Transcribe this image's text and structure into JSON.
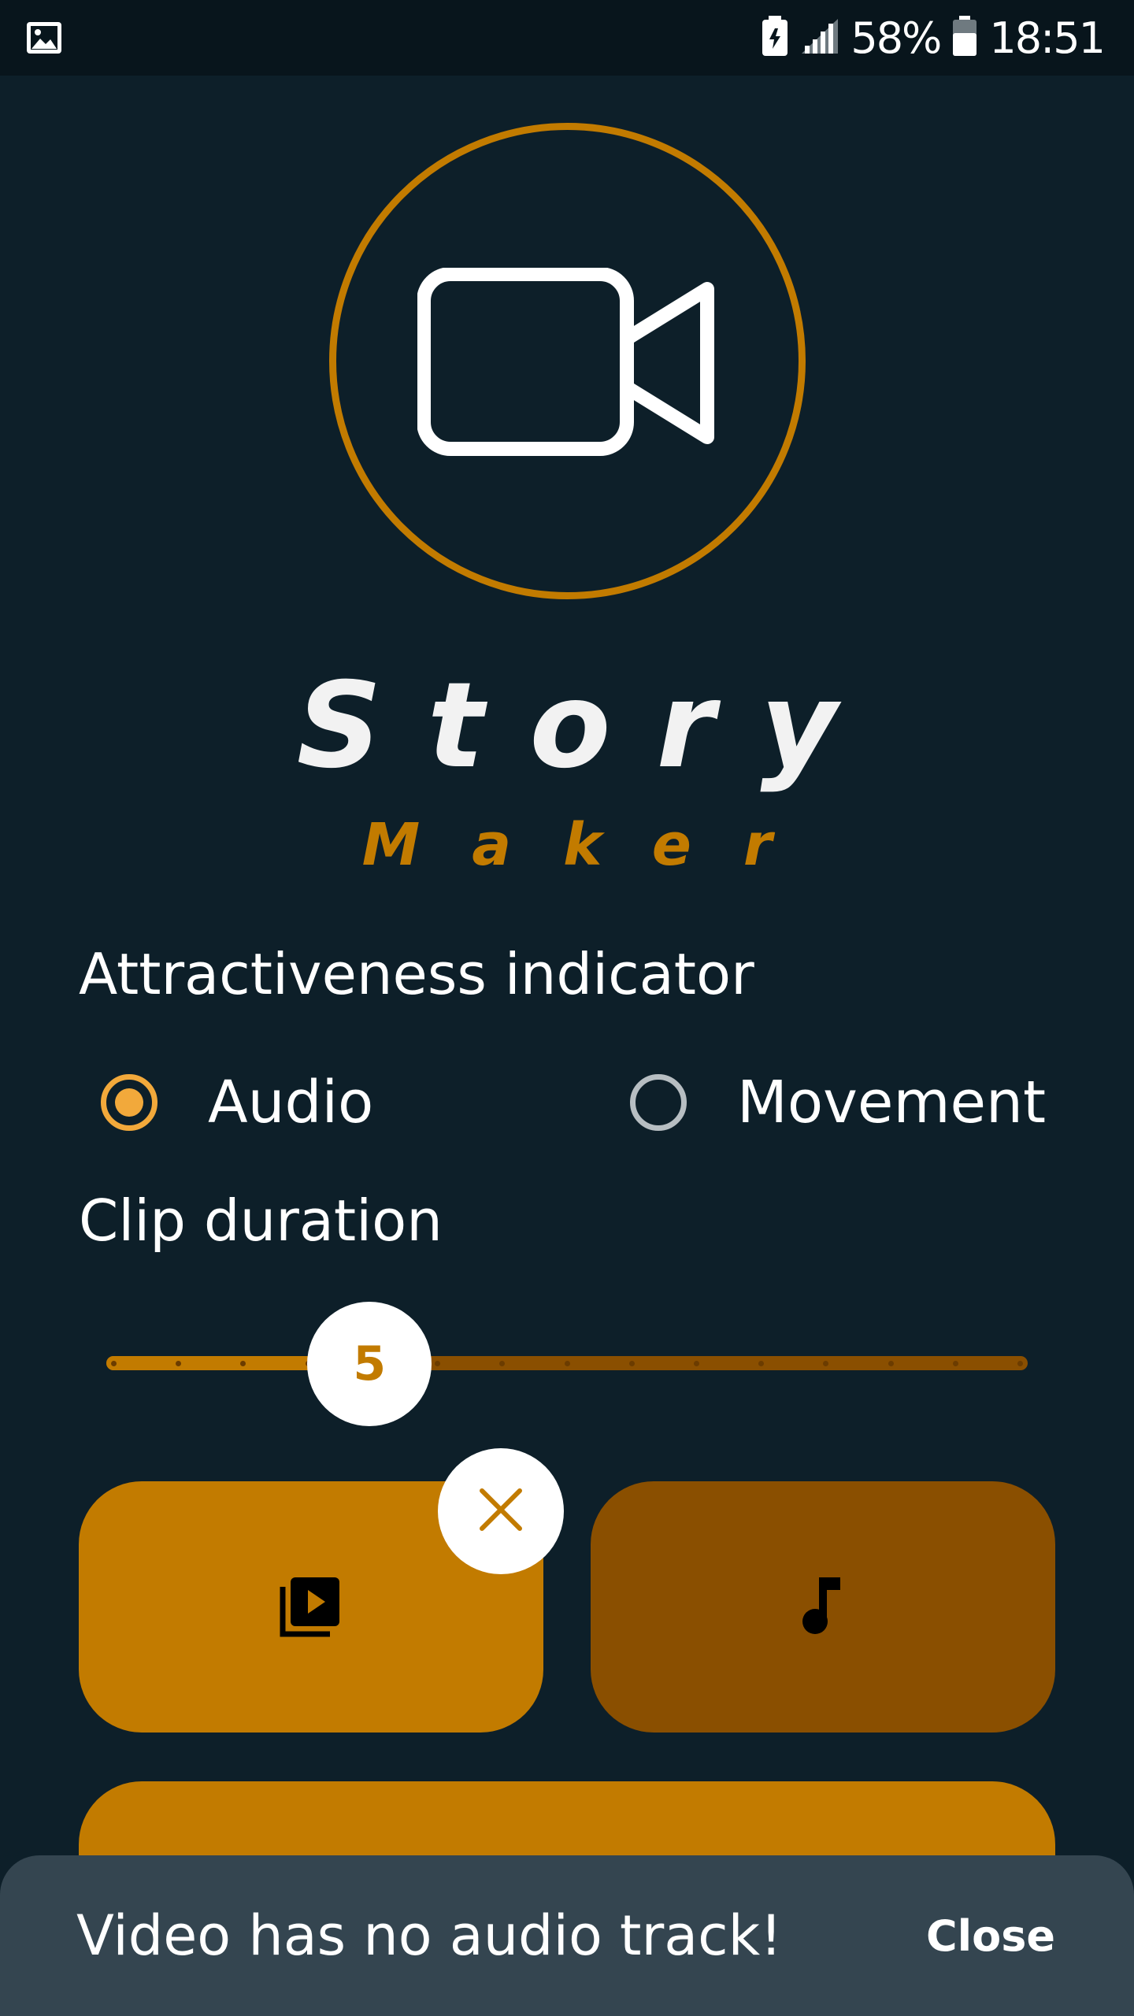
{
  "status_bar": {
    "battery_percent": "58%",
    "time": "18:51",
    "icons": [
      "image-icon",
      "battery-saver-icon",
      "signal-icon",
      "battery-icon"
    ]
  },
  "app": {
    "title_main": "Story",
    "title_sub": "Maker",
    "logo_icon": "video-camera-icon"
  },
  "colors": {
    "background": "#0d1f29",
    "accent": "#c27b00",
    "accent_dark": "#8a4f00",
    "radio_active": "#f2a93b",
    "snackbar": "#344550"
  },
  "indicator": {
    "label": "Attractiveness indicator",
    "options": [
      {
        "label": "Audio",
        "selected": true
      },
      {
        "label": "Movement",
        "selected": false
      }
    ]
  },
  "clip": {
    "label": "Clip duration",
    "value": "5",
    "value_num": 5,
    "min": 1,
    "max": 15
  },
  "buttons": {
    "video_icon": "video-library-icon",
    "music_icon": "music-note-icon",
    "remove_icon": "close-icon"
  },
  "snackbar": {
    "message": "Video has no audio track!",
    "action": "Close"
  }
}
